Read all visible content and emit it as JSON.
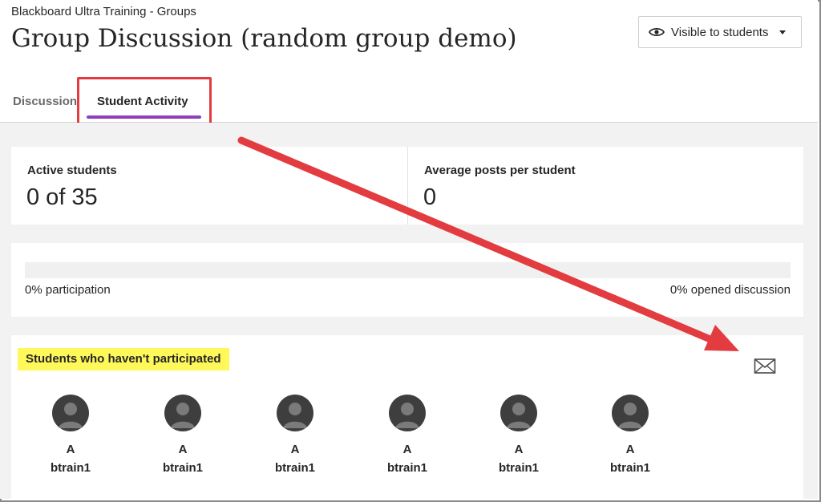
{
  "header": {
    "breadcrumb": "Blackboard Ultra Training - Groups",
    "title": "Group Discussion (random group demo)",
    "visibility_label": "Visible to students",
    "visibility_icon": "eye-icon"
  },
  "tabs": [
    {
      "label": "Discussion",
      "selected": false
    },
    {
      "label": "Student Activity",
      "selected": true
    }
  ],
  "stats": {
    "active_label": "Active students",
    "active_value": "0 of 35",
    "avg_label": "Average posts per student",
    "avg_value": "0"
  },
  "progress": {
    "participation_text": "0% participation",
    "participation_percent": 0,
    "opened_text": "0% opened discussion",
    "opened_percent": 0
  },
  "non_participants": {
    "heading": "Students who haven't participated",
    "message_icon": "envelope-icon",
    "students": [
      {
        "first": "A",
        "last": "btrain1"
      },
      {
        "first": "A",
        "last": "btrain1"
      },
      {
        "first": "A",
        "last": "btrain1"
      },
      {
        "first": "A",
        "last": "btrain1"
      },
      {
        "first": "A",
        "last": "btrain1"
      },
      {
        "first": "A",
        "last": "btrain1"
      }
    ]
  },
  "colors": {
    "accent": "#8e3fbd",
    "annotation_red": "#e23b40",
    "highlight_yellow": "#fff85a",
    "background": "#f2f2f2"
  }
}
